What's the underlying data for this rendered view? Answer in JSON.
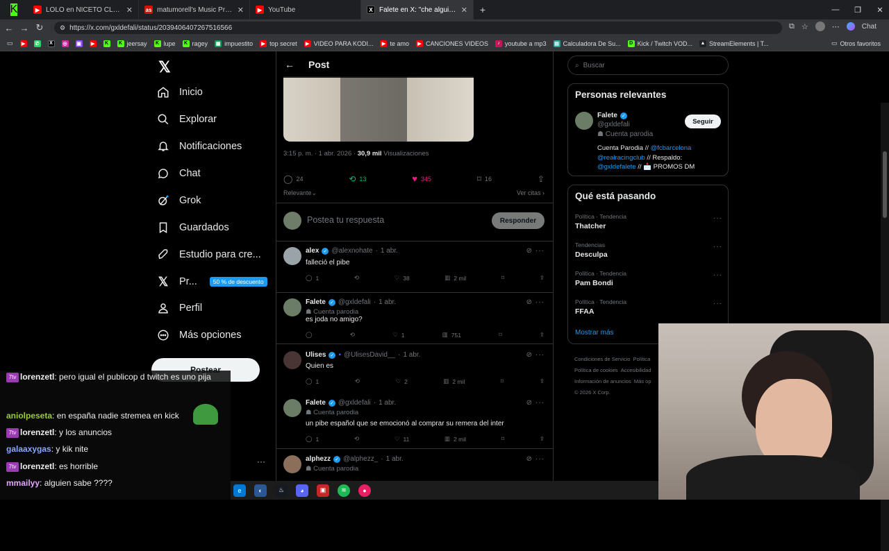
{
  "tabs": [
    {
      "label": "LOLO en NICETO CLUB (AFTERMOVIE)",
      "icon": "kick-icon",
      "color": "#53fc18"
    },
    {
      "label": "LOLO en NICETO CLUB (AFTERMO",
      "icon": "youtube-icon",
      "color": "#ff0000"
    },
    {
      "label": "matumorell's Music Profile | Last.fm",
      "icon": "lastfm-icon",
      "color": "#d51007"
    },
    {
      "label": "YouTube",
      "icon": "youtube-icon",
      "color": "#ff0000"
    },
    {
      "label": "Falete en X: \"che alguien sabe que",
      "icon": "x-icon",
      "color": "#000000"
    }
  ],
  "address": {
    "url": "https://x.com/gxldefali/status/2039406407267516566"
  },
  "bookmarks": [
    "",
    "",
    "",
    "",
    "",
    "",
    "jeersay",
    "lupe",
    "ragey",
    "impuestito",
    "top secret",
    "VIDEO PARA KODI...",
    "te amo",
    "CANCIONES VIDEOS",
    "youtube a mp3",
    "Calculadora De Su...",
    "Kick / Twitch VOD...",
    "StreamElements | T..."
  ],
  "bookmarks_other": "Otros favoritos",
  "browser_chat": "Chat",
  "nav": {
    "items": [
      "Inicio",
      "Explorar",
      "Notificaciones",
      "Chat",
      "Grok",
      "Guardados",
      "Estudio para cre...",
      "Pr...",
      "Perfil",
      "Más opciones"
    ],
    "promo": "50 % de descuento",
    "post_button": "Postear"
  },
  "main": {
    "header_title": "Post",
    "meta_time": "3:15 p. m. · 1 abr. 2026 ·",
    "meta_views": "30,9 mil",
    "meta_views_label": "Visualizaciones",
    "stats": {
      "replies": "24",
      "reposts": "13",
      "likes": "345",
      "bookmarks": "16"
    },
    "relevant": "Relevante",
    "ver_citas": "Ver citas",
    "reply_placeholder": "Postea tu respuesta",
    "reply_button": "Responder",
    "replies": [
      {
        "name": "alex",
        "handle": "@alexnohate",
        "date": "1 abr.",
        "parody": "",
        "text": "falleció el pibe",
        "r": "1",
        "rt": "",
        "l": "38",
        "v": "2 mil"
      },
      {
        "name": "Falete",
        "handle": "@gxldefali",
        "date": "1 abr.",
        "parody": "Cuenta parodia",
        "text": "es joda no amigo?",
        "r": "",
        "rt": "",
        "l": "1",
        "v": "751"
      },
      {
        "name": "Ulises",
        "handle": "@UlisesDavid__",
        "date": "1 abr.",
        "parody": "",
        "text": "Quien es",
        "r": "1",
        "rt": "",
        "l": "2",
        "v": "2 mil"
      },
      {
        "name": "Falete",
        "handle": "@gxldefali",
        "date": "1 abr.",
        "parody": "Cuenta parodia",
        "text": "un pibe español que se emocionó al comprar su remera del inter",
        "r": "1",
        "rt": "",
        "l": "11",
        "v": "2 mil"
      },
      {
        "name": "alphezz",
        "handle": "@alphezz_",
        "date": "1 abr.",
        "parody": "Cuenta parodia",
        "text": "",
        "r": "",
        "rt": "",
        "l": "",
        "v": ""
      }
    ]
  },
  "sidebar": {
    "search_placeholder": "Buscar",
    "relevant_title": "Personas relevantes",
    "person": {
      "name": "Falete",
      "handle": "@gxldefali",
      "parody": "Cuenta parodia",
      "follow": "Seguir",
      "bio_1": "Cuenta Parodia // ",
      "bio_link1": "@fcbarcelona",
      "bio_link2": "@realracingclub",
      "bio_2": " // Respaldo:",
      "bio_link3": "@gxldefalete",
      "bio_3": " // 📩 PROMOS DM"
    },
    "trends_title": "Qué está pasando",
    "trends": [
      {
        "cat": "Política · Tendencia",
        "name": "Thatcher"
      },
      {
        "cat": "Tendencias",
        "name": "Desculpa"
      },
      {
        "cat": "Política · Tendencia",
        "name": "Pam Bondi"
      },
      {
        "cat": "Política · Tendencia",
        "name": "FFAA"
      }
    ],
    "show_more": "Mostrar más",
    "footer": [
      "Condiciones de Servicio",
      "Política",
      "Política de cookies",
      "Accesibilidad",
      "Información de anuncios",
      "Más op",
      "© 2026 X Corp."
    ]
  },
  "stream_chat": [
    {
      "user": "lorenzetl",
      "msg": ": pero igual el publicop d twitch es uno pija",
      "badge": "7tv",
      "color": "#efeff1"
    },
    {
      "user": "aniolpeseta",
      "msg": ": en españa nadie stremea en kick",
      "badge": "",
      "color": "#9acd32"
    },
    {
      "user": "lorenzetl",
      "msg": ": y los anuncios",
      "badge": "7tv",
      "color": "#efeff1"
    },
    {
      "user": "galaaxygas",
      "msg": ": y kik nite",
      "badge": "",
      "color": "#8aa6ff"
    },
    {
      "user": "lorenzetl",
      "msg": ": es horrible",
      "badge": "7tv",
      "color": "#efeff1"
    },
    {
      "user": "mmailyy",
      "msg": ": alguien sabe ????",
      "badge": "",
      "color": "#e6a4ff"
    }
  ],
  "colors": {
    "accent": "#1d9bf0",
    "like": "#f91880",
    "repost": "#00ba7c",
    "bg": "#000000"
  }
}
